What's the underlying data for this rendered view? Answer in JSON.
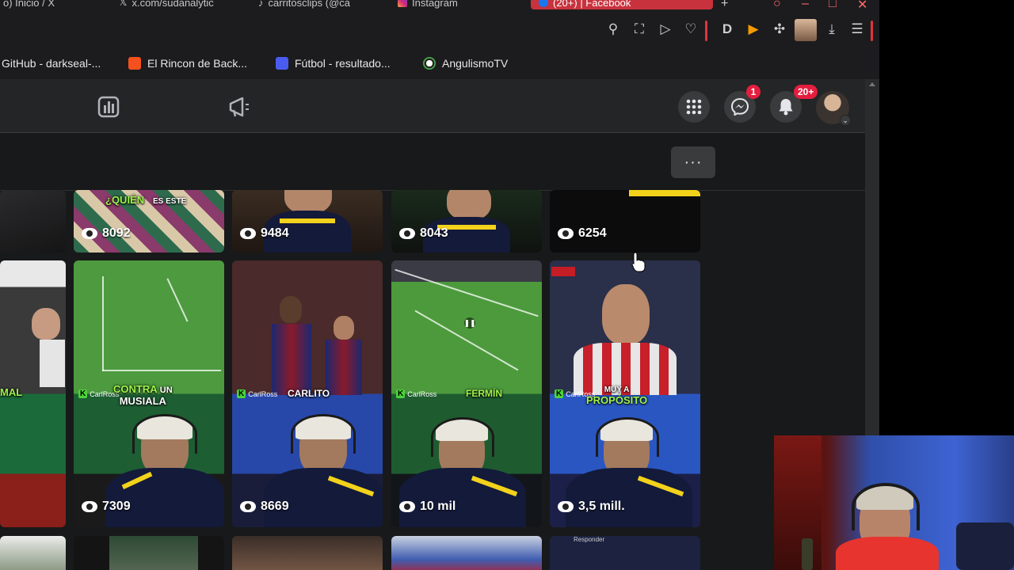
{
  "browser": {
    "tabs": [
      {
        "label": "o) Inicio / X"
      },
      {
        "label": "x.com/sudanalytic"
      },
      {
        "label": "carritosclips (@ca"
      },
      {
        "label": "Instagram"
      },
      {
        "label": "(20+) | Facebook"
      }
    ],
    "bookmarks": [
      {
        "label": "GitHub - darkseal-...",
        "icon": "github-icon"
      },
      {
        "label": "El Rincon de Back...",
        "icon": "blogger-icon",
        "color": "#f4511e"
      },
      {
        "label": "Fútbol - resultado...",
        "icon": "sports-icon",
        "color": "#4a5cf0"
      },
      {
        "label": "AngulismoTV",
        "icon": "soccer-ball-icon"
      }
    ]
  },
  "fb": {
    "messenger_badge": "1",
    "notifications_badge": "20+",
    "more_label": "···"
  },
  "reels": {
    "top_row": [
      {
        "views": ""
      },
      {
        "views": "8092",
        "caption_top": "¿QUIÉN",
        "caption_top2": "ES ESTE"
      },
      {
        "views": "9484"
      },
      {
        "views": "8043"
      },
      {
        "views": "6254"
      }
    ],
    "mid_row": [
      {
        "caption": "MAL",
        "views": ""
      },
      {
        "caption": "CONTRA",
        "caption2": "UN",
        "caption3": "MUSIALA",
        "views": "7309",
        "brand": "CarlRoss"
      },
      {
        "caption": "CARLITO",
        "views": "8669",
        "brand": "CarlRoss"
      },
      {
        "caption": "FERMÍN",
        "views": "10 mil",
        "brand": "CarlRoss"
      },
      {
        "caption": "MUY A",
        "caption2": "PROPÓSITO",
        "views": "3,5 mill.",
        "brand": "CarlRoss"
      }
    ],
    "bottom_row_partial_text": "Responder"
  },
  "colors": {
    "fb_bg": "#18191a",
    "fb_header": "#242526",
    "badge_red": "#e41e3f",
    "caption_green": "#9ef34a"
  }
}
